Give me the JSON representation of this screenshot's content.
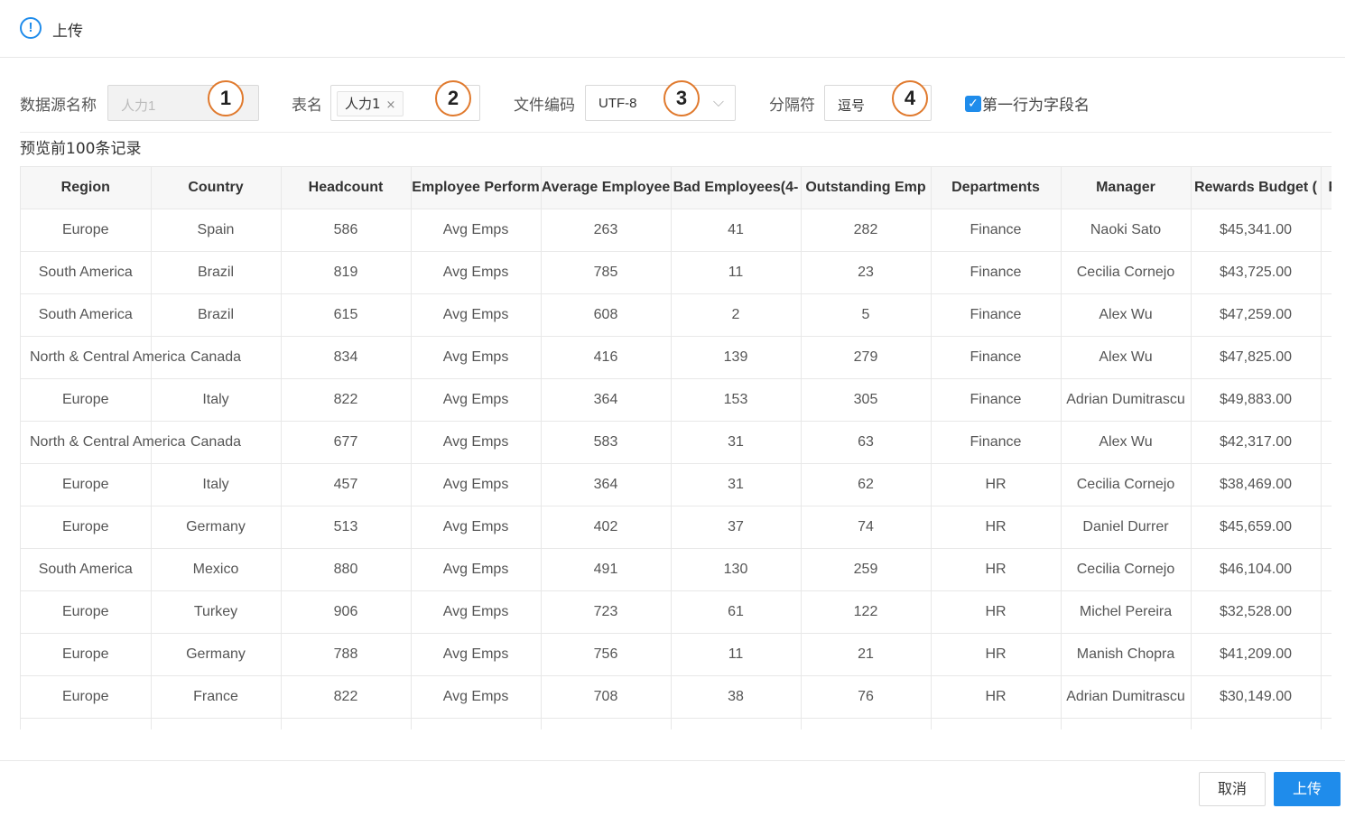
{
  "header": {
    "title": "上传",
    "icon": "info-icon"
  },
  "form": {
    "datasource_label": "数据源名称",
    "datasource_value": "人力1",
    "table_label": "表名",
    "table_tag": "人力1",
    "encoding_label": "文件编码",
    "encoding_value": "UTF-8",
    "delimiter_label": "分隔符",
    "delimiter_value": "逗号",
    "first_row_label": "第一行为字段名",
    "first_row_checked": true
  },
  "badges": [
    "1",
    "2",
    "3",
    "4"
  ],
  "preview_title": "预览前100条记录",
  "table": {
    "headers": [
      "Region",
      "Country",
      "Headcount",
      "Employee Perform",
      "Average Employee",
      "Bad Employees(4-",
      "Outstanding Emp",
      "Departments",
      "Manager",
      "Rewards Budget (",
      "F"
    ],
    "rows": [
      [
        "Europe",
        "Spain",
        "586",
        "Avg Emps",
        "263",
        "41",
        "282",
        "Finance",
        "Naoki Sato",
        "$45,341.00"
      ],
      [
        "South America",
        "Brazil",
        "819",
        "Avg Emps",
        "785",
        "11",
        "23",
        "Finance",
        "Cecilia Cornejo",
        "$43,725.00"
      ],
      [
        "South America",
        "Brazil",
        "615",
        "Avg Emps",
        "608",
        "2",
        "5",
        "Finance",
        "Alex Wu",
        "$47,259.00"
      ],
      [
        "North & Central America",
        "Canada",
        "834",
        "Avg Emps",
        "416",
        "139",
        "279",
        "Finance",
        "Alex Wu",
        "$47,825.00"
      ],
      [
        "Europe",
        "Italy",
        "822",
        "Avg Emps",
        "364",
        "153",
        "305",
        "Finance",
        "Adrian Dumitrascu",
        "$49,883.00"
      ],
      [
        "North & Central America",
        "Canada",
        "677",
        "Avg Emps",
        "583",
        "31",
        "63",
        "Finance",
        "Alex Wu",
        "$42,317.00"
      ],
      [
        "Europe",
        "Italy",
        "457",
        "Avg Emps",
        "364",
        "31",
        "62",
        "HR",
        "Cecilia Cornejo",
        "$38,469.00"
      ],
      [
        "Europe",
        "Germany",
        "513",
        "Avg Emps",
        "402",
        "37",
        "74",
        "HR",
        "Daniel Durrer",
        "$45,659.00"
      ],
      [
        "South America",
        "Mexico",
        "880",
        "Avg Emps",
        "491",
        "130",
        "259",
        "HR",
        "Cecilia Cornejo",
        "$46,104.00"
      ],
      [
        "Europe",
        "Turkey",
        "906",
        "Avg Emps",
        "723",
        "61",
        "122",
        "HR",
        "Michel Pereira",
        "$32,528.00"
      ],
      [
        "Europe",
        "Germany",
        "788",
        "Avg Emps",
        "756",
        "11",
        "21",
        "HR",
        "Manish Chopra",
        "$41,209.00"
      ],
      [
        "Europe",
        "France",
        "822",
        "Avg Emps",
        "708",
        "38",
        "76",
        "HR",
        "Adrian Dumitrascu",
        "$30,149.00"
      ]
    ]
  },
  "footer": {
    "cancel_label": "取消",
    "upload_label": "上传"
  },
  "colors": {
    "primary": "#1f8ceb",
    "badge_border": "#e07a2e"
  }
}
